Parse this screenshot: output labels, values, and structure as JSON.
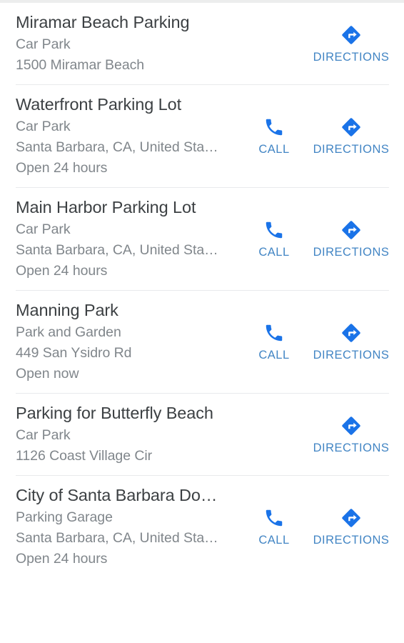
{
  "screen": {
    "app": "maps-place-results-list",
    "background_color": "#ffffff",
    "top_edge_color": "#eceded"
  },
  "colors": {
    "title_text": "#3c4043",
    "secondary_text": "#80868b",
    "action_blue": "#4285c4",
    "icon_blue": "#1a73e8",
    "divider": "#e8eaec"
  },
  "actions": {
    "call_label": "CALL",
    "directions_label": "DIRECTIONS",
    "call_icon": "phone-icon",
    "directions_icon": "directions-diamond-icon"
  },
  "results": [
    {
      "title": "Miramar Beach Parking",
      "category": "Car Park",
      "address": "1500 Miramar Beach",
      "hours": "",
      "has_call": false,
      "has_directions": true
    },
    {
      "title": "Waterfront Parking Lot",
      "category": "Car Park",
      "address": "Santa Barbara, CA, United Sta…",
      "hours": "Open 24 hours",
      "has_call": true,
      "has_directions": true
    },
    {
      "title": "Main Harbor Parking Lot",
      "category": "Car Park",
      "address": "Santa Barbara, CA, United Sta…",
      "hours": "Open 24 hours",
      "has_call": true,
      "has_directions": true
    },
    {
      "title": "Manning Park",
      "category": "Park and Garden",
      "address": "449 San Ysidro Rd",
      "hours": "Open now",
      "has_call": true,
      "has_directions": true
    },
    {
      "title": "Parking for Butterfly Beach",
      "category": "Car Park",
      "address": "1126 Coast Village Cir",
      "hours": "",
      "has_call": false,
      "has_directions": true
    },
    {
      "title": "City of Santa Barbara Do…",
      "category": "Parking Garage",
      "address": "Santa Barbara, CA, United Sta…",
      "hours": "Open 24 hours",
      "has_call": true,
      "has_directions": true
    }
  ]
}
